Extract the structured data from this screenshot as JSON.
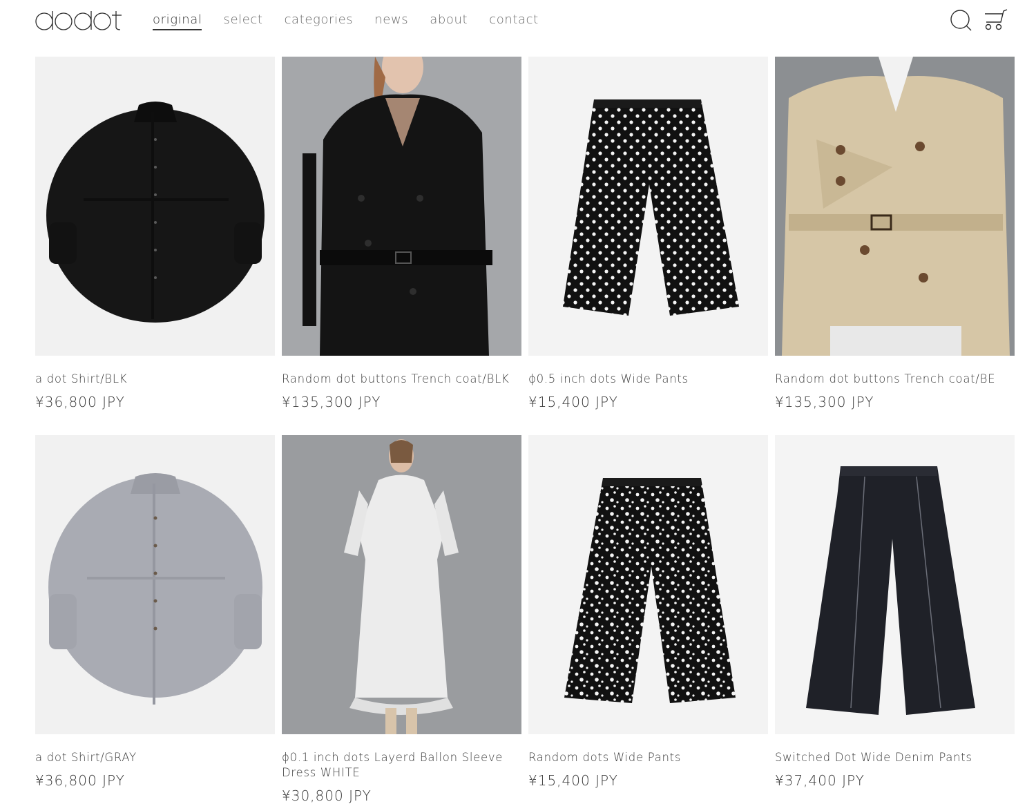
{
  "brand": {
    "logo_text": "dodot"
  },
  "nav": {
    "items": [
      {
        "label": "original",
        "active": true
      },
      {
        "label": "select",
        "active": false
      },
      {
        "label": "categories",
        "active": false
      },
      {
        "label": "news",
        "active": false
      },
      {
        "label": "about",
        "active": false
      },
      {
        "label": "contact",
        "active": false
      }
    ]
  },
  "header_icons": {
    "search": "search-icon",
    "cart": "cart-icon"
  },
  "products": [
    {
      "title": "a dot Shirt/BLK",
      "price": "¥36,800 JPY"
    },
    {
      "title": "Random dot buttons Trench coat/BLK",
      "price": "¥135,300 JPY"
    },
    {
      "title": "ϕ0.5 inch dots Wide Pants",
      "price": "¥15,400 JPY"
    },
    {
      "title": "Random dot buttons Trench coat/BE",
      "price": "¥135,300 JPY"
    },
    {
      "title": "a dot Shirt/GRAY",
      "price": "¥36,800 JPY"
    },
    {
      "title": "ϕ0.1 inch dots Layerd Ballon Sleeve Dress WHITE",
      "price": "¥30,800 JPY"
    },
    {
      "title": "Random dots Wide Pants",
      "price": "¥15,400 JPY"
    },
    {
      "title": "Switched Dot Wide Denim Pants",
      "price": "¥37,400 JPY"
    }
  ],
  "colors": {
    "text": "#3a3a3a",
    "nav_inactive": "#6a6a6a",
    "background": "#ffffff"
  }
}
